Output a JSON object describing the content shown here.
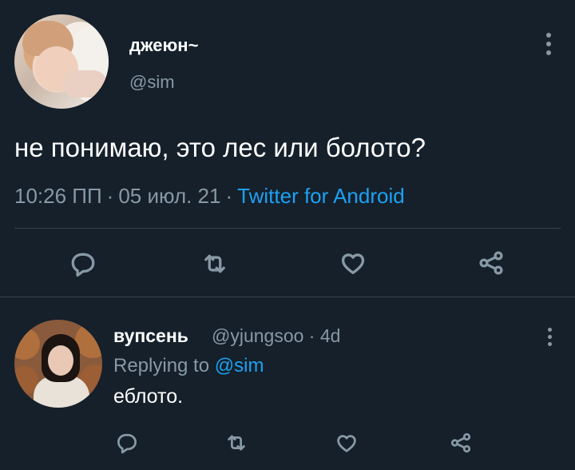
{
  "main_tweet": {
    "display_name": "джеюн~",
    "handle": "@sim",
    "text": "не понимаю, это лес или болото?",
    "time": "10:26 ПП",
    "separator": "·",
    "date": "05 июл. 21",
    "source": "Twitter for Android"
  },
  "reply_tweet": {
    "display_name": "вупсень",
    "handle_and_age": "@yjungsoo · 4d",
    "replying_label": "Replying to",
    "replying_mention": "@sim",
    "text": "еблото."
  },
  "icons": [
    "more-vertical-icon",
    "reply-icon",
    "retweet-icon",
    "like-icon",
    "share-icon"
  ],
  "colors": {
    "background": "#15202b",
    "primary_text": "#ffffff",
    "secondary_text": "#8899a6",
    "accent": "#1da1f2",
    "divider": "#38444d"
  }
}
